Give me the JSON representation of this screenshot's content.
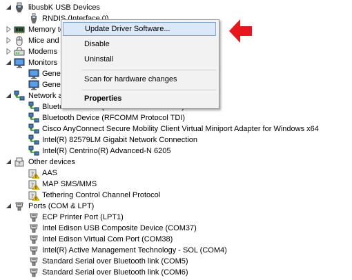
{
  "tree": [
    {
      "label": "libusbK USB Devices",
      "icon": "usb-controller-icon",
      "expander": "expanded",
      "level": 0
    },
    {
      "label": "RNDIS (Interface 0)",
      "icon": "usb-device-icon",
      "level": 1
    },
    {
      "label": "Memory technology devices",
      "icon": "memory-icon",
      "expander": "collapsed",
      "level": 0
    },
    {
      "label": "Mice and other pointing devices",
      "icon": "mouse-icon",
      "expander": "collapsed",
      "level": 0
    },
    {
      "label": "Modems",
      "icon": "modem-icon",
      "expander": "collapsed",
      "level": 0
    },
    {
      "label": "Monitors",
      "icon": "monitor-icon",
      "expander": "expanded",
      "level": 0
    },
    {
      "label": "Generic PnP Monitor",
      "icon": "monitor-icon",
      "level": 1
    },
    {
      "label": "Generic PnP Monitor",
      "icon": "monitor-icon",
      "level": 1
    },
    {
      "label": "Network adapters",
      "icon": "network-adapter-icon",
      "expander": "expanded",
      "level": 0
    },
    {
      "label": "Bluetooth Device (Personal Area Network)",
      "icon": "network-adapter-icon",
      "level": 1
    },
    {
      "label": "Bluetooth Device (RFCOMM Protocol TDI)",
      "icon": "network-adapter-icon",
      "level": 1
    },
    {
      "label": "Cisco AnyConnect Secure Mobility Client Virtual Miniport Adapter for Windows x64",
      "icon": "network-adapter-icon",
      "level": 1
    },
    {
      "label": "Intel(R) 82579LM Gigabit Network Connection",
      "icon": "network-adapter-icon",
      "level": 1
    },
    {
      "label": "Intel(R) Centrino(R) Advanced-N 6205",
      "icon": "network-adapter-icon",
      "level": 1
    },
    {
      "label": "Other devices",
      "icon": "unknown-device-icon",
      "expander": "expanded",
      "level": 0
    },
    {
      "label": "AAS",
      "icon": "unknown-device-warning-icon",
      "level": 1
    },
    {
      "label": "MAP SMS/MMS",
      "icon": "unknown-device-warning-icon",
      "level": 1
    },
    {
      "label": "Tethering Control Channel Protocol",
      "icon": "unknown-device-warning-icon",
      "level": 1
    },
    {
      "label": "Ports (COM & LPT)",
      "icon": "port-icon",
      "expander": "expanded",
      "level": 0
    },
    {
      "label": "ECP Printer Port (LPT1)",
      "icon": "port-icon",
      "level": 1
    },
    {
      "label": "Intel Edison USB Composite Device (COM37)",
      "icon": "port-icon",
      "level": 1
    },
    {
      "label": "Intel Edison Virtual Com Port (COM38)",
      "icon": "port-icon",
      "level": 1
    },
    {
      "label": "Intel(R) Active Management Technology - SOL (COM4)",
      "icon": "port-icon",
      "level": 1
    },
    {
      "label": "Standard Serial over Bluetooth link (COM5)",
      "icon": "port-icon",
      "level": 1
    },
    {
      "label": "Standard Serial over Bluetooth link (COM6)",
      "icon": "port-icon",
      "level": 1
    }
  ],
  "context_menu": {
    "update_driver": "Update Driver Software...",
    "disable": "Disable",
    "uninstall": "Uninstall",
    "scan": "Scan for hardware changes",
    "properties": "Properties"
  },
  "colors": {
    "menu_highlight": "#dae8f7",
    "annotation_arrow": "#e8141e"
  }
}
